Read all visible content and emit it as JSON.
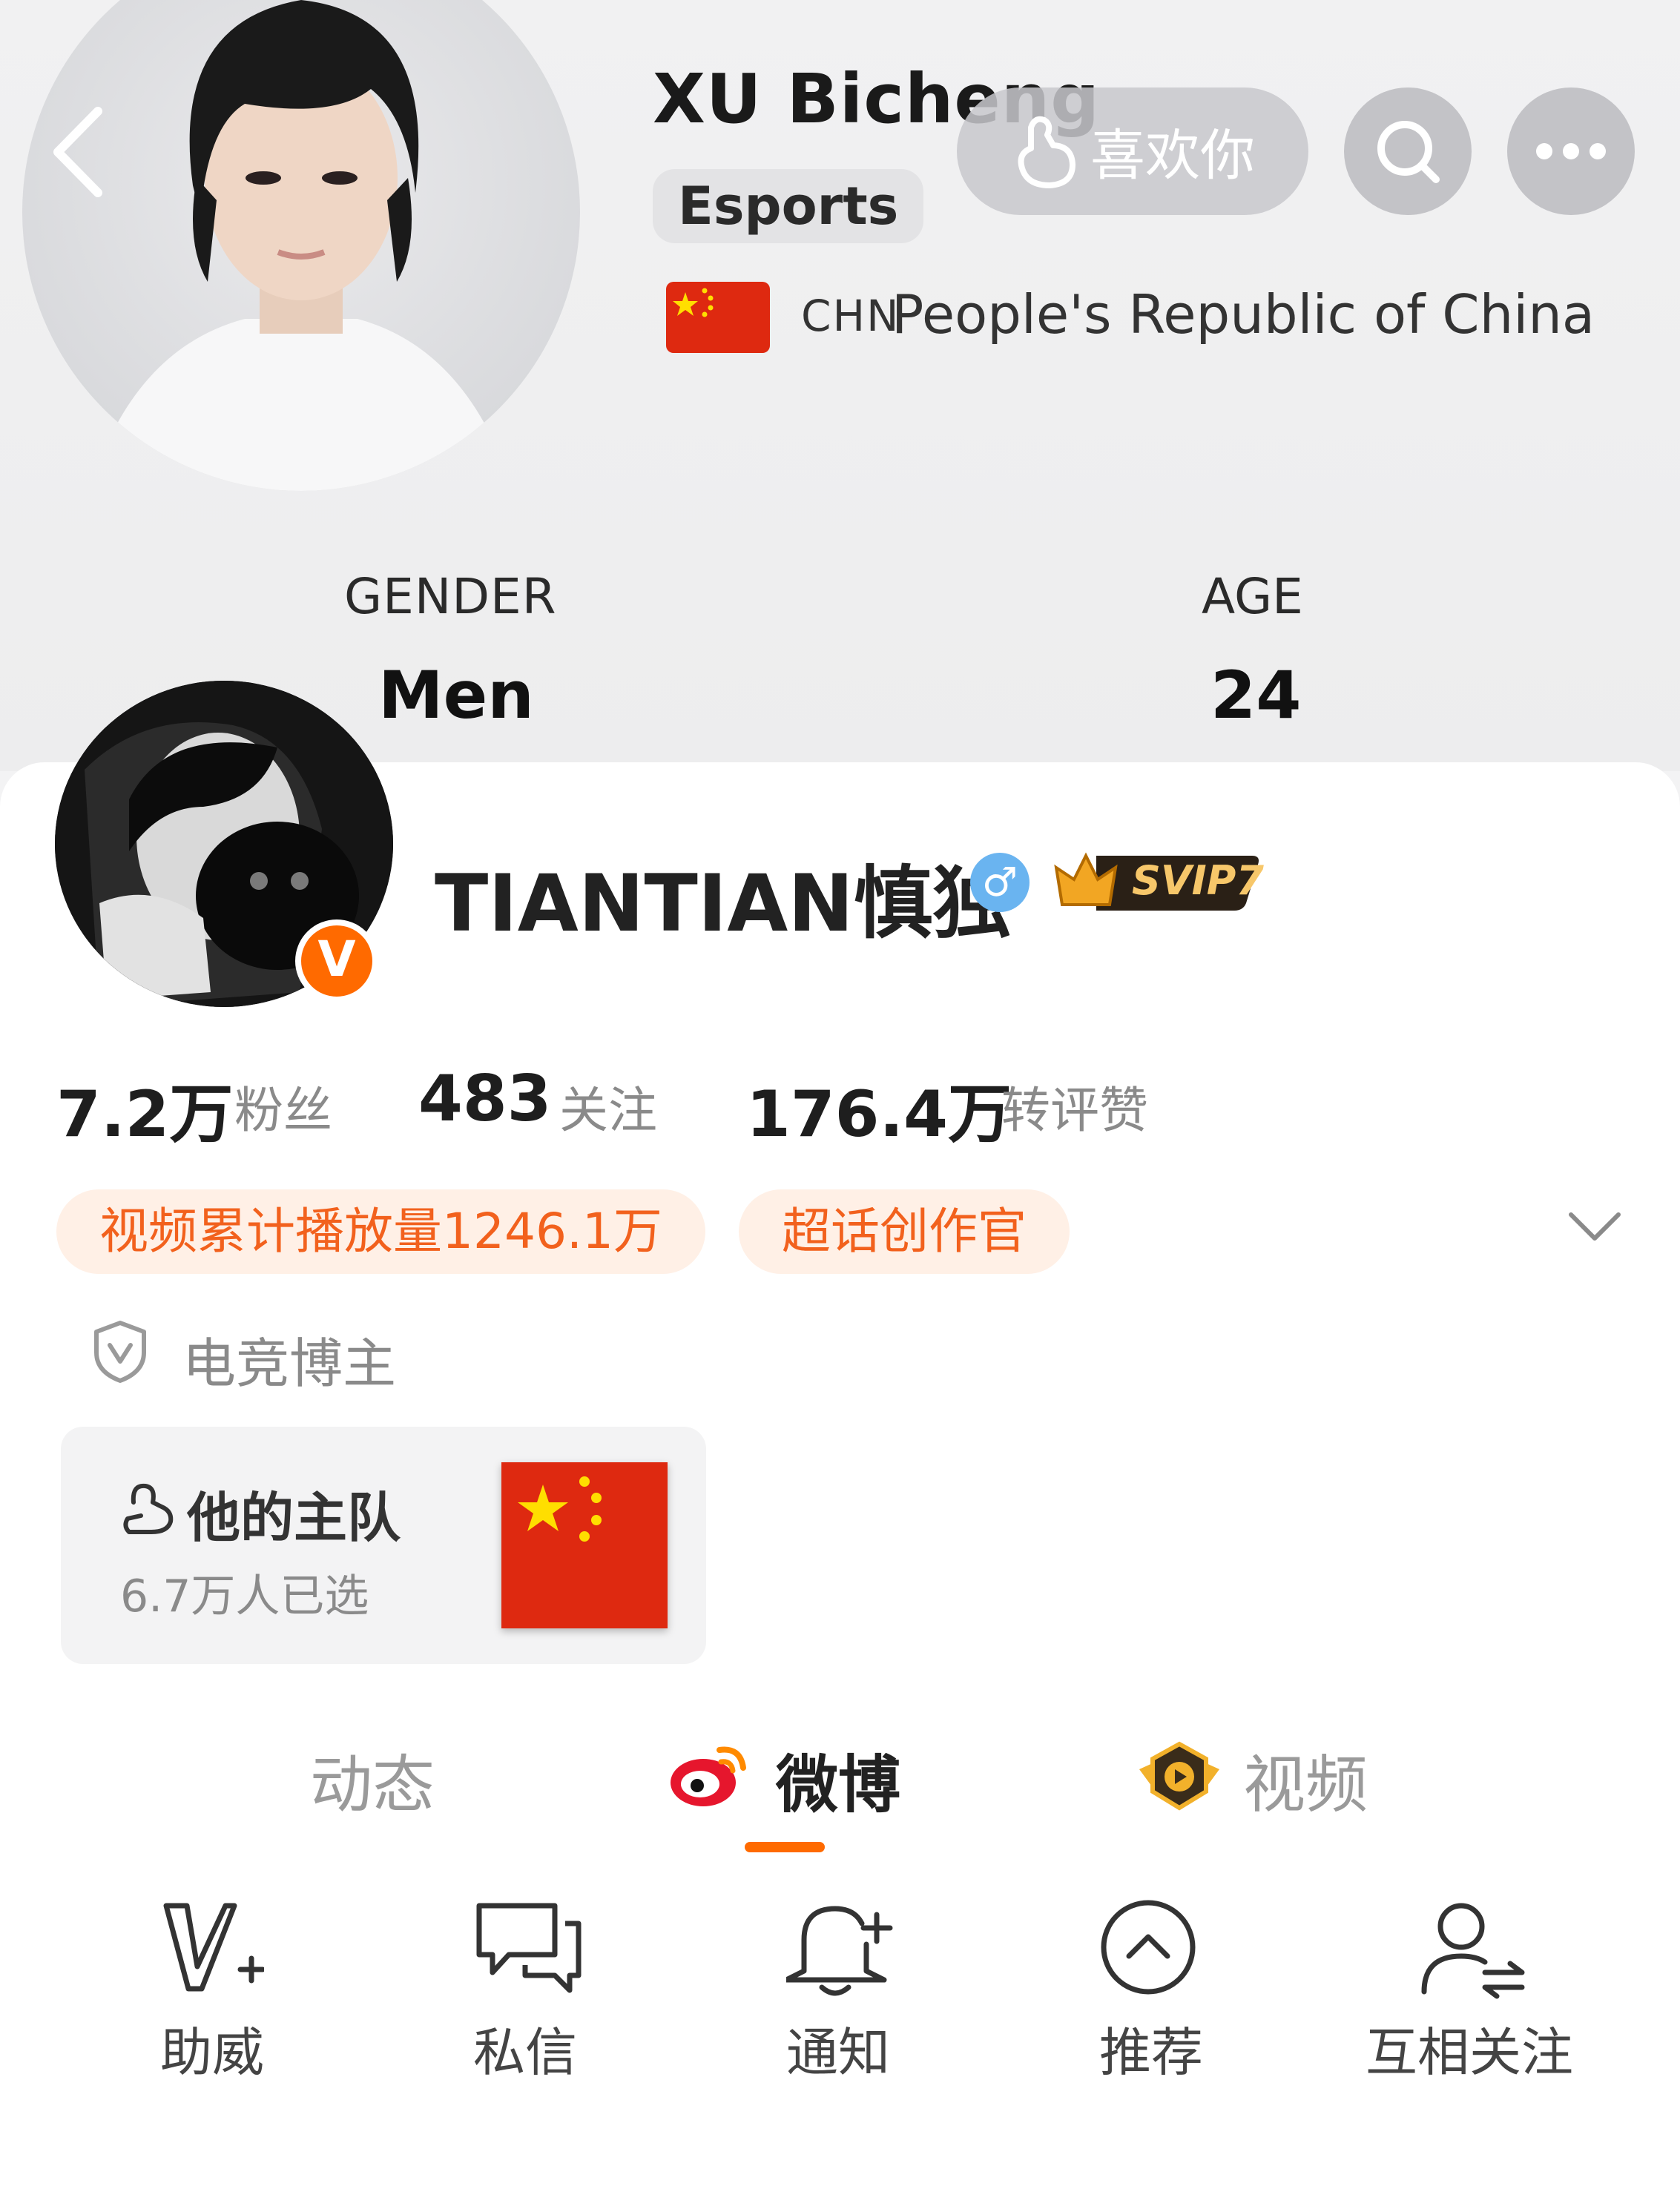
{
  "banner": {
    "athlete_name": "XU Bicheng",
    "sport": "Esports",
    "country_code": "CHN",
    "country_name": "People's Republic of China",
    "like_label": "喜欢你",
    "gender_label": "GENDER",
    "gender_value": "Men",
    "age_label": "AGE",
    "age_value": "24"
  },
  "profile": {
    "username": "TIANTIAN慎独",
    "verified_mark": "V",
    "gender_symbol": "♂",
    "vip_badge": "SVIP7",
    "accent_color": "#ff6a00"
  },
  "stats": [
    {
      "value": "7.2万",
      "label": "粉丝"
    },
    {
      "value": "483",
      "label": "关注"
    },
    {
      "value": "176.4万",
      "label": "转评赞"
    }
  ],
  "tags": [
    "视频累计播放量1246.1万",
    "超话创作官"
  ],
  "role": "电竞博主",
  "team": {
    "title": "他的主队",
    "count": "6.7万人已选"
  },
  "tabs": [
    {
      "label": "动态",
      "icon": "none",
      "active": false
    },
    {
      "label": "微博",
      "icon": "weibo-logo-icon",
      "active": true
    },
    {
      "label": "视频",
      "icon": "video-play-icon",
      "active": false
    }
  ],
  "actions": [
    {
      "label": "助威",
      "icon": "cheer-v-plus-icon"
    },
    {
      "label": "私信",
      "icon": "message-bubbles-icon"
    },
    {
      "label": "通知",
      "icon": "bell-plus-icon"
    },
    {
      "label": "推荐",
      "icon": "recommend-up-icon"
    },
    {
      "label": "互相关注",
      "icon": "mutual-follow-icon"
    }
  ]
}
